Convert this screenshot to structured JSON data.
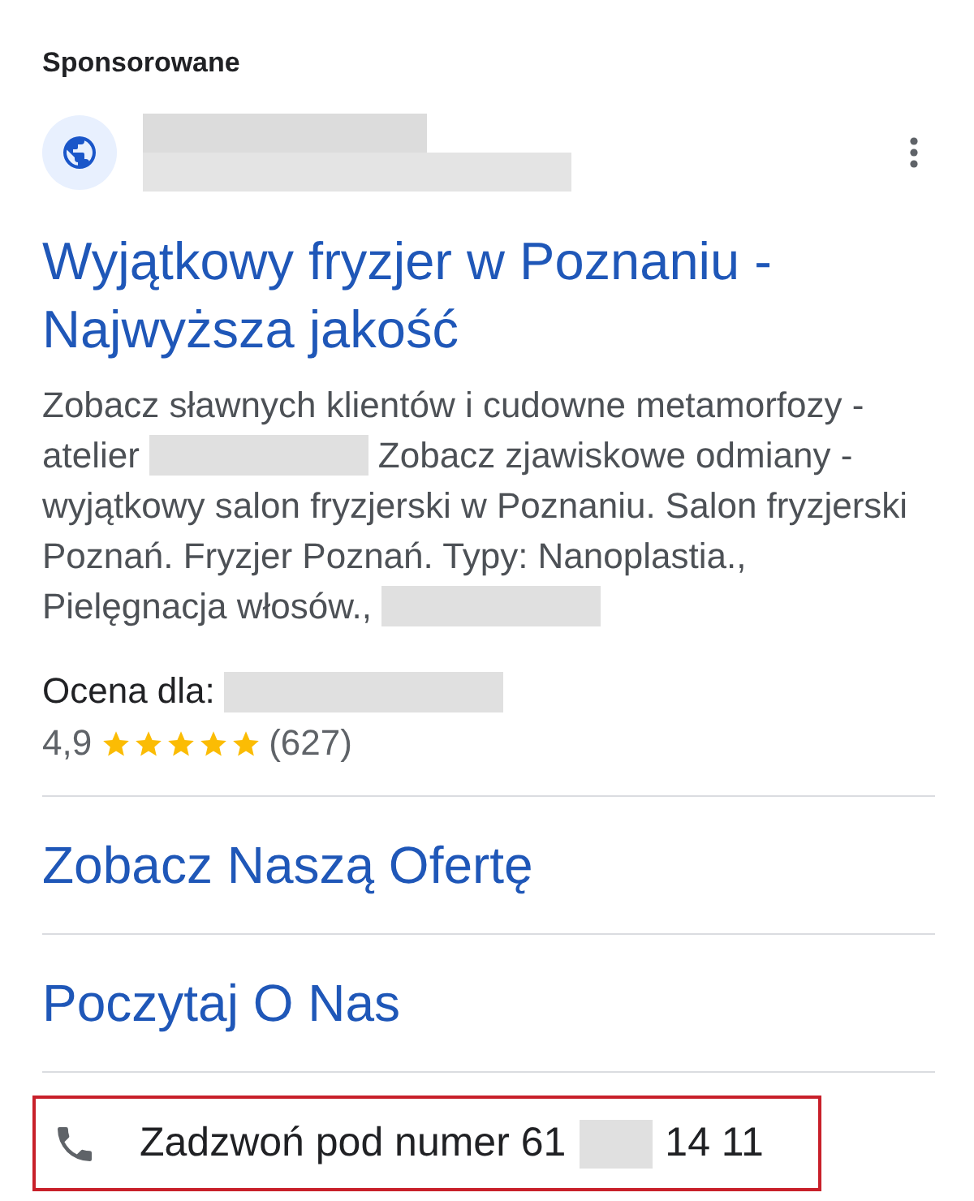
{
  "label": "Sponsorowane",
  "title": "Wyjątkowy fryzjer w Poznaniu - Najwyższa jakość",
  "description": [
    [
      {
        "kind": "text",
        "text": "Zobacz sławnych klientów i cudowne metamorfozy -"
      }
    ],
    [
      {
        "kind": "text",
        "text": "atelier"
      },
      {
        "kind": "redacted"
      },
      {
        "kind": "text",
        "text": "Zobacz zjawiskowe odmiany -"
      }
    ],
    [
      {
        "kind": "text",
        "text": "wyjątkowy salon fryzjerski w Poznaniu. Salon fryzjerski"
      }
    ],
    [
      {
        "kind": "text",
        "text": "Poznań. Fryzjer Poznań. Typy: Nanoplastia.,"
      }
    ],
    [
      {
        "kind": "text",
        "text": "Pielęgnacja włosów.,"
      },
      {
        "kind": "redacted"
      }
    ]
  ],
  "rating": {
    "label": "Ocena dla:",
    "value": "4,9",
    "stars": 5,
    "count": "(627)"
  },
  "links": [
    "Zobacz Naszą Ofertę",
    "Poczytaj O Nas"
  ],
  "call": [
    {
      "kind": "text",
      "text": "Zadzwoń pod numer 61"
    },
    {
      "kind": "redacted"
    },
    {
      "kind": "text",
      "text": "14 11"
    }
  ]
}
